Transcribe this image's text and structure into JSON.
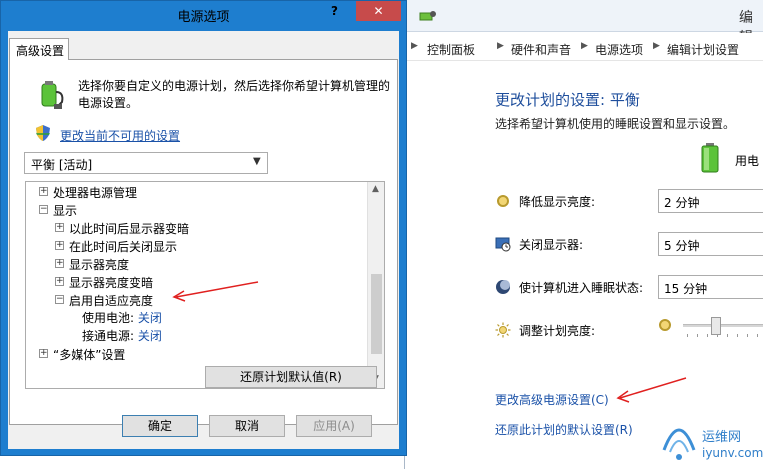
{
  "background_window": {
    "title": "编辑",
    "breadcrumb": [
      "控制面板",
      "硬件和声音",
      "电源选项",
      "编辑计划设置"
    ],
    "heading": "更改计划的设置: 平衡",
    "subtext": "选择希望计算机使用的睡眠设置和显示设置。",
    "plugged_in_label": "用电",
    "settings": [
      {
        "label": "降低显示亮度:",
        "value": "2 分钟",
        "icon": "dim-display-icon"
      },
      {
        "label": "关闭显示器:",
        "value": "5 分钟",
        "icon": "monitor-off-icon"
      },
      {
        "label": "使计算机进入睡眠状态:",
        "value": "15 分钟",
        "icon": "sleep-moon-icon"
      }
    ],
    "brightness_label": "调整计划亮度:",
    "brightness_level": 0.4,
    "link_advanced": "更改高级电源设置(C)",
    "link_restore": "还原此计划的默认设置(R)"
  },
  "watermark": {
    "name": "运维网",
    "domain": "iyunv.com"
  },
  "dialog": {
    "title": "电源选项",
    "close_symbol": "✕",
    "help_symbol": "?",
    "tab_label": "高级设置",
    "intro_text": "选择你要自定义的电源计划，然后选择你希望计算机管理的电源设置。",
    "link_unavailable": "更改当前不可用的设置",
    "plan_selected": "平衡 [活动]",
    "tree": [
      {
        "label": "处理器电源管理",
        "toggle": "+",
        "level": 0
      },
      {
        "label": "显示",
        "toggle": "−",
        "level": 0
      },
      {
        "label": "以此时间后显示器变暗",
        "toggle": "+",
        "level": 1
      },
      {
        "label": "在此时间后关闭显示",
        "toggle": "+",
        "level": 1
      },
      {
        "label": "显示器亮度",
        "toggle": "+",
        "level": 1
      },
      {
        "label": "显示器亮度变暗",
        "toggle": "+",
        "level": 1
      },
      {
        "label": "启用自适应亮度",
        "toggle": "−",
        "level": 1
      },
      {
        "label": "使用电池:",
        "value": "关闭",
        "level": 2
      },
      {
        "label": "接通电源:",
        "value": "关闭",
        "level": 2
      },
      {
        "label": "“多媒体”设置",
        "toggle": "+",
        "level": 0
      }
    ],
    "restore_button": "还原计划默认值(R)",
    "ok_button": "确定",
    "cancel_button": "取消",
    "apply_button": "应用(A)"
  },
  "colors": {
    "accent_link": "#1b52a8",
    "heading_blue": "#1e4e9c",
    "dialog_frame": "#1e7ecf",
    "close_red": "#c74b4b",
    "annotation_red": "#e0201f"
  }
}
